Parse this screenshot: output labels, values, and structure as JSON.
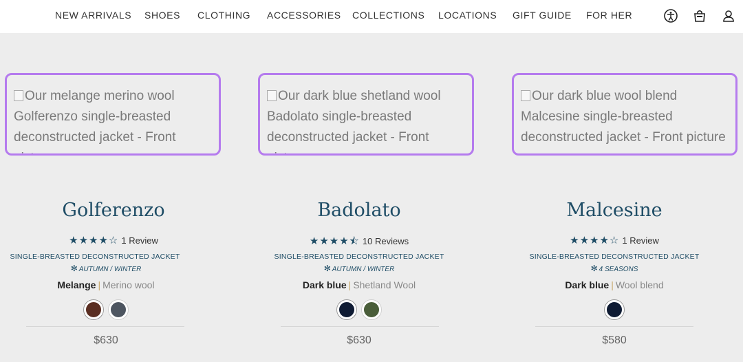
{
  "nav": {
    "links": [
      "NEW ARRIVALS",
      "SHOES",
      "CLOTHING",
      "ACCESSORIES",
      "COLLECTIONS",
      "LOCATIONS",
      "GIFT GUIDE",
      "FOR HER"
    ],
    "icons": [
      "accessibility-icon",
      "bag-icon",
      "account-icon"
    ]
  },
  "products": [
    {
      "image_alt": "Our melange merino wool Golferenzo single-breasted deconstructed jacket - Front picture",
      "name": "Golferenzo",
      "stars": "★★★★☆",
      "reviews": "1 Review",
      "type": "SINGLE-BREASTED DECONSTRUCTED JACKET",
      "season": "AUTUMN / WINTER",
      "color": "Melange",
      "material": "Merino wool",
      "swatches": [
        "#5a2e22",
        "#4d5560"
      ],
      "price": "$630"
    },
    {
      "image_alt": "Our dark blue shetland wool Badolato single-breasted deconstructed jacket - Front picture",
      "name": "Badolato",
      "stars": "★★★★⯪",
      "reviews": "10 Reviews",
      "type": "SINGLE-BREASTED DECONSTRUCTED JACKET",
      "season": "AUTUMN / WINTER",
      "color": "Dark blue",
      "material": "Shetland Wool",
      "swatches": [
        "#0f1b33",
        "#4a5e3a"
      ],
      "price": "$630"
    },
    {
      "image_alt": "Our dark blue wool blend Malcesine single-breasted deconstructed jacket - Front picture",
      "name": "Malcesine",
      "stars": "★★★★☆",
      "reviews": "1 Review",
      "type": "SINGLE-BREASTED DECONSTRUCTED JACKET",
      "season": "4 SEASONS",
      "color": "Dark blue",
      "material": "Wool blend",
      "swatches": [
        "#0f1b33"
      ],
      "price": "$580"
    }
  ],
  "colors": {
    "accent": "#1f4d66",
    "focus_outline": "#b57bee",
    "page_bg": "#ededed"
  }
}
